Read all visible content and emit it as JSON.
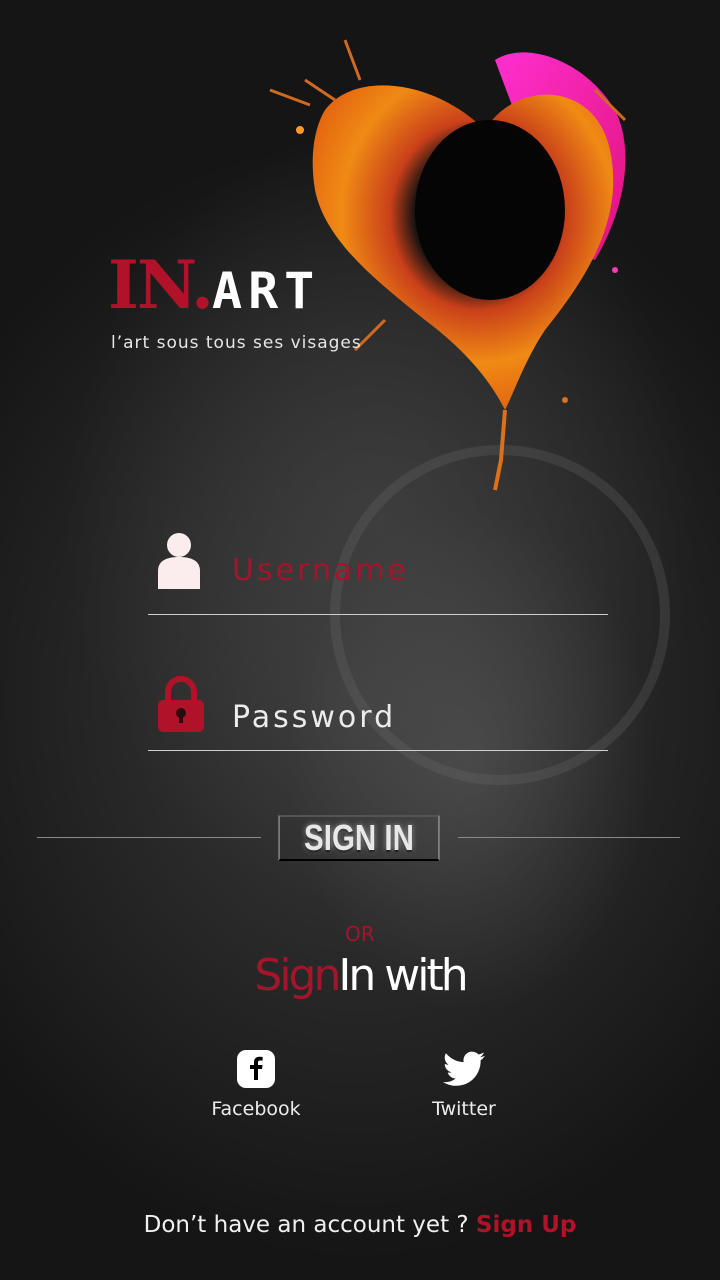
{
  "brand": {
    "logo_in": "IN.",
    "logo_art": "ART",
    "tagline": "l’art sous tous ses visages"
  },
  "login": {
    "username_placeholder": "Username",
    "password_placeholder": "Password",
    "signin_label": "SIGN IN"
  },
  "social": {
    "or_label": "OR",
    "signin_with_part1": "Sign",
    "signin_with_part2": "In with",
    "facebook_label": "Facebook",
    "twitter_label": "Twitter"
  },
  "footer": {
    "prompt": "Don’t have an account yet ? ",
    "signup_label": "Sign Up"
  },
  "colors": {
    "accent": "#a1162a",
    "background": "#1e1e1e",
    "text": "#ffffff"
  },
  "icons": [
    "user-icon",
    "lock-icon",
    "facebook-icon",
    "twitter-icon"
  ]
}
